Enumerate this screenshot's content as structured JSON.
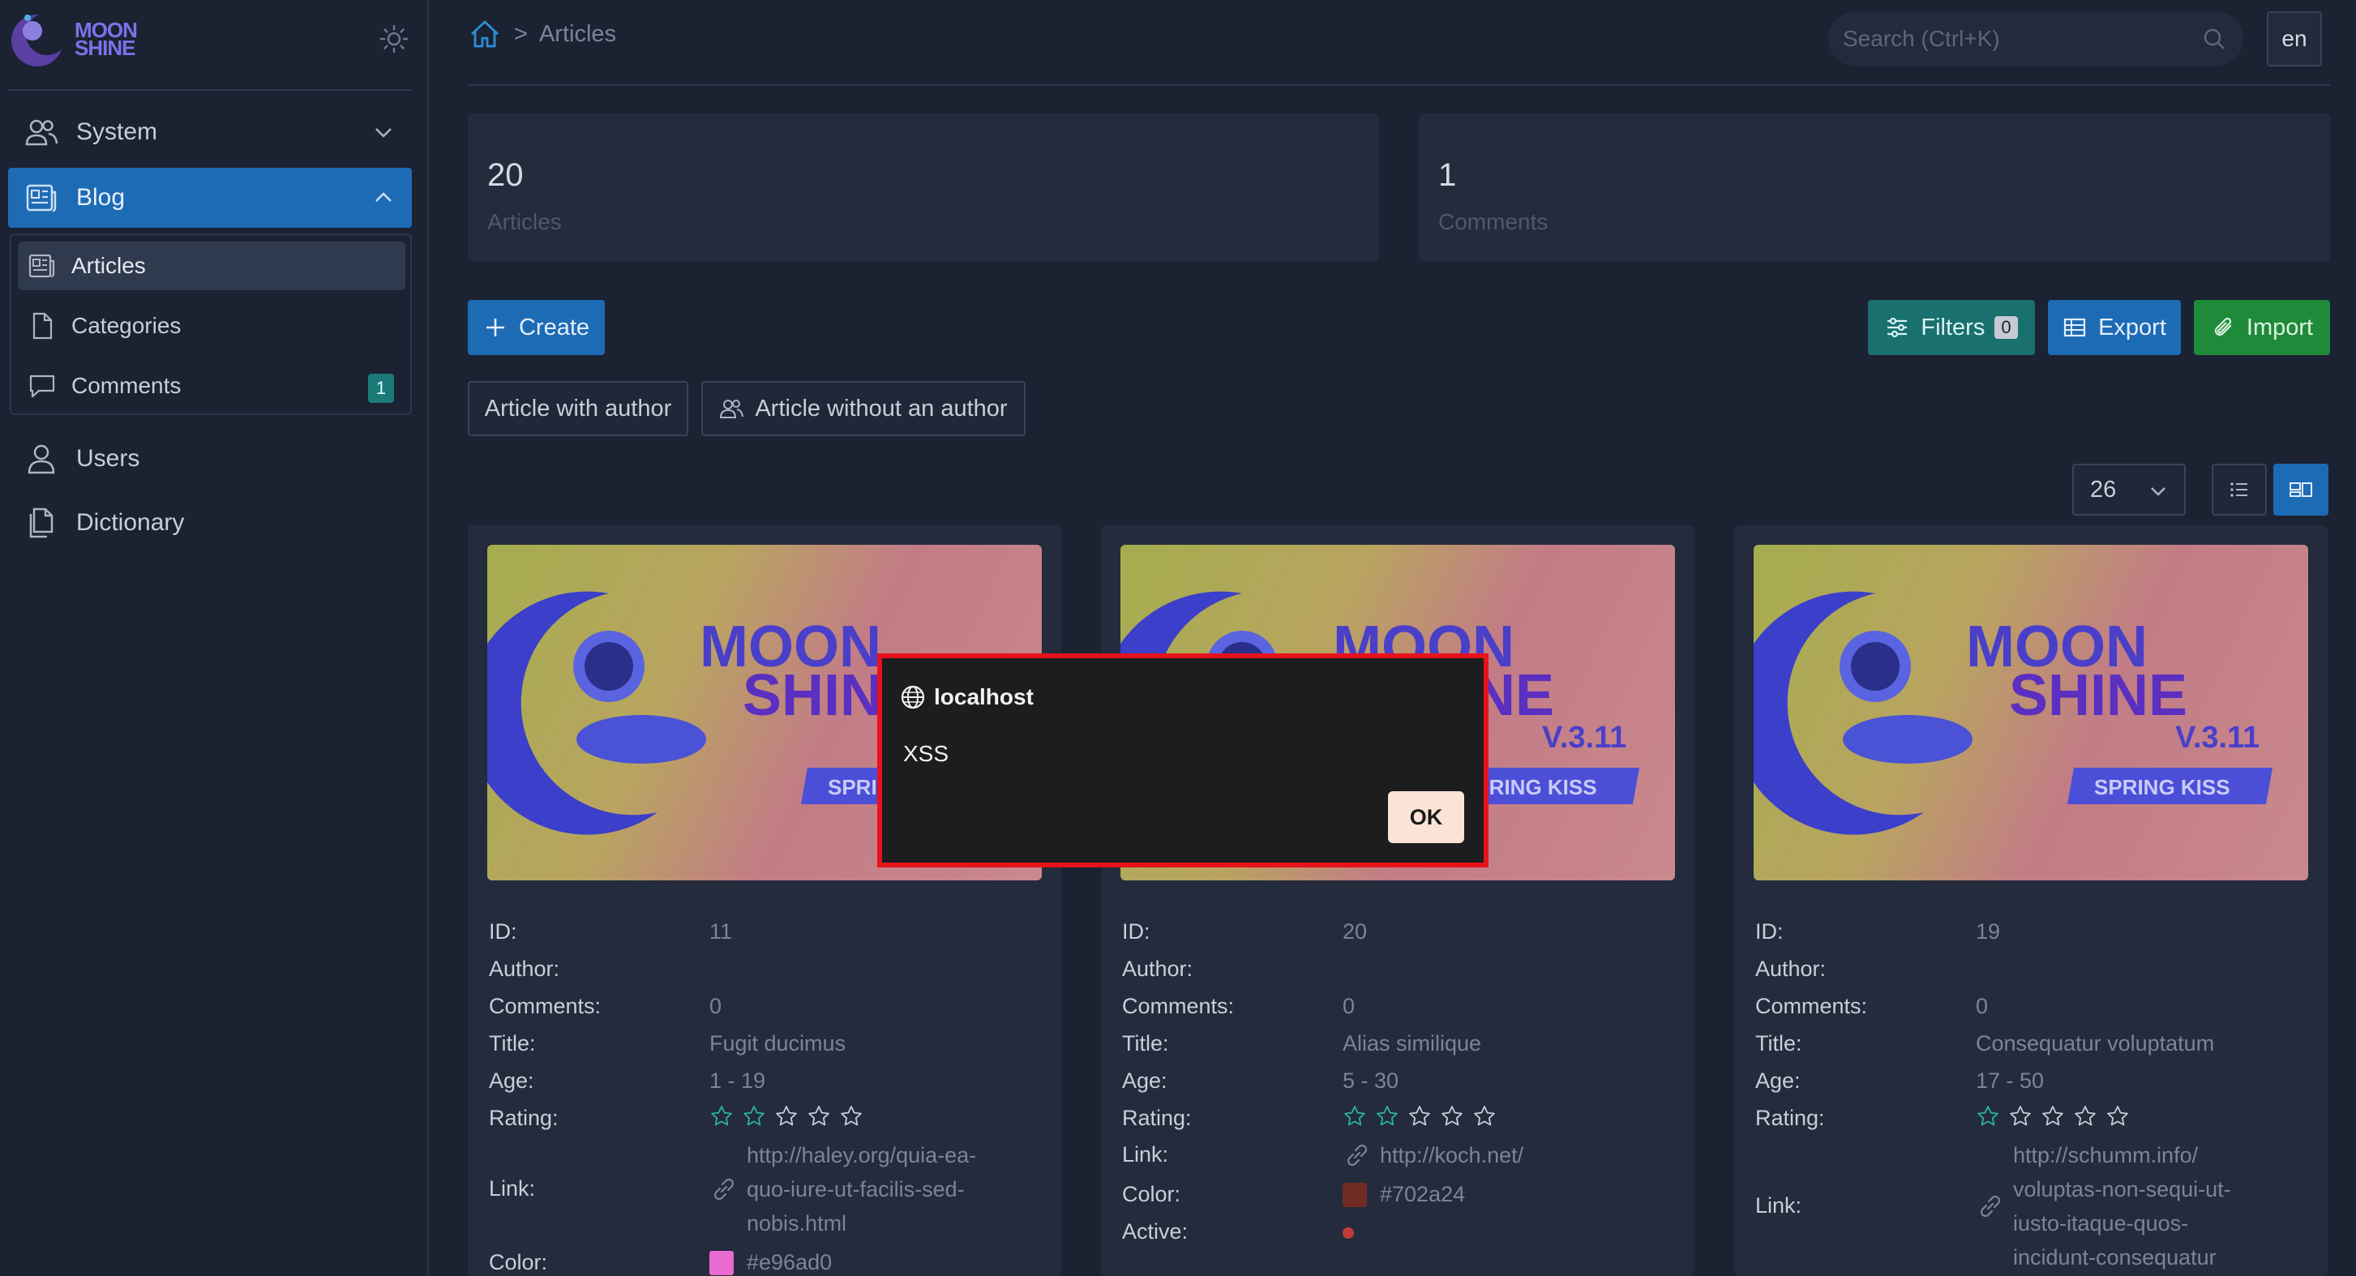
{
  "sidebar": {
    "logo_text_1": "MOON",
    "logo_text_2": "SHINE",
    "items": [
      {
        "label": "System"
      },
      {
        "label": "Blog"
      },
      {
        "label": "Users"
      },
      {
        "label": "Dictionary"
      }
    ],
    "blog_submenu": [
      {
        "label": "Articles"
      },
      {
        "label": "Categories"
      },
      {
        "label": "Comments",
        "badge": "1"
      }
    ]
  },
  "header": {
    "breadcrumb_current": "Articles",
    "breadcrumb_separator": ">",
    "search_placeholder": "Search (Ctrl+K)",
    "language": "en"
  },
  "metrics": [
    {
      "value": "20",
      "label": "Articles"
    },
    {
      "value": "1",
      "label": "Comments"
    }
  ],
  "toolbar": {
    "create_label": "Create",
    "filters_label": "Filters",
    "filters_count": "0",
    "export_label": "Export",
    "import_label": "Import",
    "query_tags": [
      "Article with author",
      "Article without an author"
    ],
    "per_page": "26"
  },
  "field_labels": {
    "id": "ID:",
    "author": "Author:",
    "comments": "Comments:",
    "title": "Title:",
    "age": "Age:",
    "rating": "Rating:",
    "link": "Link:",
    "color": "Color:",
    "active": "Active:"
  },
  "cards": [
    {
      "id": "11",
      "author": "",
      "comments": "0",
      "title": "Fugit ducimus",
      "age": "1 - 19",
      "rating_filled": 2,
      "rating_max": 5,
      "link_lines": [
        "http://haley.org/quia-ea-",
        "quo-iure-ut-facilis-sed-",
        "nobis.html"
      ],
      "color_hex": "#e96ad0",
      "color_label": "#e96ad0"
    },
    {
      "id": "20",
      "author": "",
      "comments": "0",
      "title": "Alias similique",
      "age": "5 - 30",
      "rating_filled": 2,
      "rating_max": 5,
      "link_lines": [
        "http://koch.net/"
      ],
      "color_hex": "#702a24",
      "color_label": "#702a24",
      "active": true
    },
    {
      "id": "19",
      "author": "",
      "comments": "0",
      "title": "Consequatur voluptatum",
      "age": "17 - 50",
      "rating_filled": 1,
      "rating_max": 5,
      "link_lines": [
        "http://schumm.info/",
        "voluptas-non-sequi-ut-",
        "iusto-itaque-quos-",
        "incidunt-consequatur"
      ]
    }
  ],
  "card_image": {
    "line1": "MOON",
    "line2": "SHINE",
    "version": "V.3.11",
    "tagline": "SPRING KISS"
  },
  "dialog": {
    "origin": "localhost",
    "message": "XSS",
    "ok_label": "OK"
  },
  "colors": {
    "accent_blue": "#1d6bb5",
    "teal": "#19706f",
    "green": "#1f8a3a",
    "dialog_border": "#e8121b",
    "active_dot": "#c23b3b"
  }
}
